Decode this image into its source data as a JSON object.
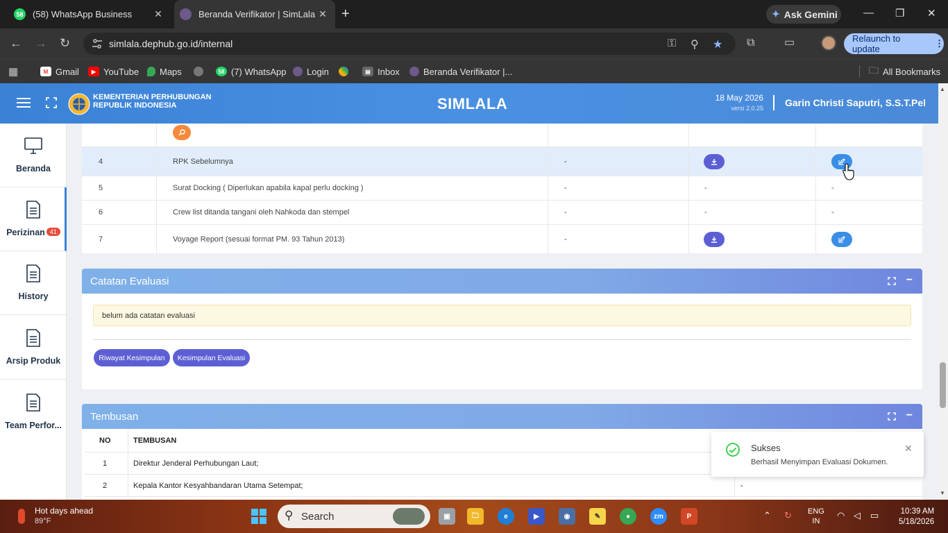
{
  "browser": {
    "tabs": [
      {
        "title": "(58) WhatsApp Business",
        "badge": "58"
      },
      {
        "title": "Beranda Verifikator | SimLala"
      }
    ],
    "ask_gemini": "Ask Gemini",
    "url": "simlala.dephub.go.id/internal",
    "relaunch": "Relaunch to update",
    "bookmarks": [
      {
        "label": "Gmail"
      },
      {
        "label": "YouTube"
      },
      {
        "label": "Maps"
      },
      {
        "label": "(7) WhatsApp",
        "badge": "58"
      },
      {
        "label": "Login"
      },
      {
        "label": "Inbox"
      },
      {
        "label": "Beranda Verifikator |..."
      }
    ],
    "all_bookmarks": "All Bookmarks"
  },
  "header": {
    "ministry_line1": "KEMENTERIAN PERHUBUNGAN",
    "ministry_line2": "REPUBLIK INDONESIA",
    "app_title": "SIMLALA",
    "date": "18 May 2026",
    "version": "versi 2.0.25",
    "user": "Garin Christi Saputri, S.S.T.Pel"
  },
  "sidebar": {
    "items": [
      {
        "label": "Beranda"
      },
      {
        "label": "Perizinan",
        "badge": "41"
      },
      {
        "label": "History"
      },
      {
        "label": "Arsip Produk"
      },
      {
        "label": "Team Perfor..."
      }
    ]
  },
  "documents": {
    "rows": [
      {
        "no": "4",
        "name": "RPK Sebelumnya",
        "col3": "-",
        "download": true,
        "edit": true
      },
      {
        "no": "5",
        "name": "Surat Docking ( Diperlukan apabila kapal perlu docking )",
        "col3": "-",
        "col4": "-",
        "col5": "-"
      },
      {
        "no": "6",
        "name": "Crew list ditanda tangani oleh Nahkoda dan stempel",
        "col3": "-",
        "col4": "-",
        "col5": "-"
      },
      {
        "no": "7",
        "name": "Voyage Report (sesuai format PM. 93 Tahun 2013)",
        "col3": "-",
        "download": true,
        "edit": true
      }
    ]
  },
  "evaluasi": {
    "title": "Catatan Evaluasi",
    "note": "belum ada catatan evaluasi",
    "btn_riwayat": "Riwayat Kesimpulan",
    "btn_kesimpulan": "Kesimpulan Evaluasi"
  },
  "tembusan": {
    "title": "Tembusan",
    "headers": [
      "NO",
      "TEMBUSAN"
    ],
    "rows": [
      {
        "no": "1",
        "text": "Direktur Jenderal Perhubungan Laut;"
      },
      {
        "no": "2",
        "text": "Kepala Kantor Kesyahbandaran Utama Setempat;",
        "extra": "-"
      }
    ]
  },
  "toast": {
    "title": "Sukses",
    "message": "Berhasil Menyimpan Evaluasi Dokumen."
  },
  "taskbar": {
    "weather_title": "Hot days ahead",
    "weather_temp": "89°F",
    "search": "Search",
    "lang1": "ENG",
    "lang2": "IN",
    "time": "10:39 AM",
    "date": "5/18/2026"
  },
  "colors": {
    "header_blue": "#4a90e2",
    "download_btn": "#5c5fd4",
    "edit_btn": "#3a8ee6",
    "search_btn": "#f58a3c",
    "badge_red": "#e74c3c",
    "success_green": "#2ecc40"
  }
}
